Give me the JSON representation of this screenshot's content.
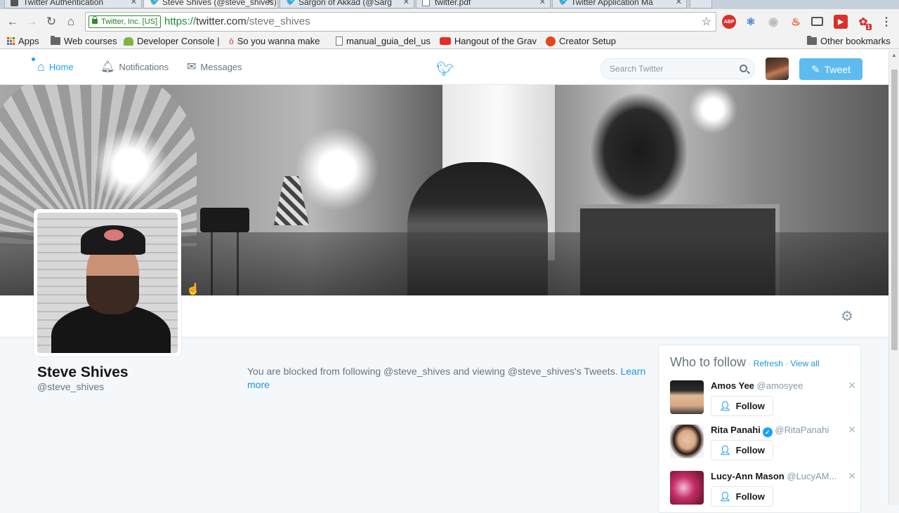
{
  "browser": {
    "tabs": [
      {
        "title": "Twitter Authentication",
        "active": false
      },
      {
        "title": "Steve Shives (@steve_shives)",
        "active": true
      },
      {
        "title": "Sargon of Akkad (@Sarg",
        "active": false
      },
      {
        "title": "twitter.pdf",
        "active": false
      },
      {
        "title": "Twitter Application Ma",
        "active": false
      }
    ],
    "security_label": "Twitter, Inc. [US]",
    "url_scheme": "https://",
    "url_host": "twitter.com",
    "url_path": "/steve_shives",
    "extensions": [
      "ABP",
      "1"
    ],
    "bookmarks": [
      {
        "label": "Apps",
        "icon": "apps-grid-icon"
      },
      {
        "label": "Web courses",
        "icon": "folder-icon"
      },
      {
        "label": "Developer Console |",
        "icon": "android-icon"
      },
      {
        "label": "So you wanna make",
        "icon": "bookmark-icon"
      },
      {
        "label": "manual_guia_del_us",
        "icon": "page-icon"
      },
      {
        "label": "Hangout of the Grav",
        "icon": "youtube-icon"
      },
      {
        "label": "Creator Setup",
        "icon": "patreon-icon"
      }
    ],
    "other_bookmarks": "Other bookmarks"
  },
  "nav": {
    "home": "Home",
    "notifications": "Notifications",
    "messages": "Messages",
    "search_placeholder": "Search Twitter",
    "tweet": "Tweet"
  },
  "profile": {
    "name": "Steve Shives",
    "handle": "@steve_shives",
    "blocked_text": "You are blocked from following @steve_shives and viewing @steve_shives's Tweets. ",
    "learn_more": "Learn more"
  },
  "who_to_follow": {
    "title": "Who to follow",
    "sep": " · ",
    "refresh": "Refresh",
    "view_all": "View all",
    "follow_label": "Follow",
    "suggestions": [
      {
        "name": "Amos Yee",
        "handle": "@amosyee",
        "verified": false
      },
      {
        "name": "Rita Panahi",
        "handle": "@RitaPanahi",
        "verified": true
      },
      {
        "name": "Lucy-Ann Mason",
        "handle": "@LucyAM...",
        "verified": false
      }
    ]
  },
  "colors": {
    "accent": "#1da1f2",
    "tweet_button": "#5ebbef",
    "link": "#1b95e0"
  }
}
